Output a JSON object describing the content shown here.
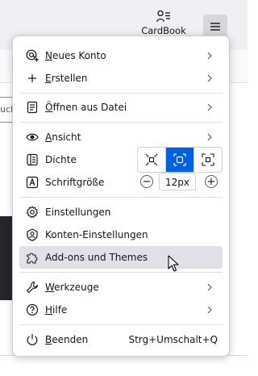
{
  "toolbar": {
    "cardbook_label": "CardBook"
  },
  "background": {
    "search_fragment": "uch"
  },
  "menu": {
    "items": {
      "new_account": {
        "accesskey": "N",
        "rest": "eues Konto"
      },
      "create": {
        "accesskey": "E",
        "rest": "rstellen"
      },
      "open_file": {
        "accesskey": "Ö",
        "rest": "ffnen aus Datei"
      },
      "view": {
        "accesskey": "A",
        "rest": "nsicht"
      },
      "density": {
        "label": "Dichte"
      },
      "font_size": {
        "label": "Schriftgröße",
        "value": "12px",
        "decrease": "−",
        "increase": "+"
      },
      "settings": {
        "label": "Einstellungen"
      },
      "account_settings": {
        "label": "Konten-Einstellungen"
      },
      "addons": {
        "label": "Add-ons und Themes"
      },
      "tools": {
        "accesskey": "W",
        "rest": "erkzeuge"
      },
      "help": {
        "accesskey": "H",
        "rest": "ilfe"
      },
      "quit": {
        "accesskey": "B",
        "rest": "eenden",
        "shortcut": "Strg+Umschalt+Q"
      }
    }
  },
  "colors": {
    "accent": "#0061e0",
    "hover": "#e0e0e6",
    "text": "#15141a"
  }
}
